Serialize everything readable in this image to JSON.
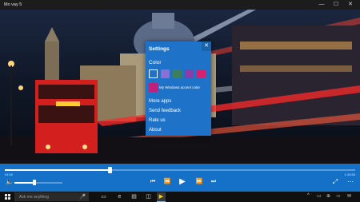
{
  "window": {
    "title": "Mo vay 5",
    "minimize_glyph": "—",
    "maximize_glyph": "☐",
    "close_glyph": "✕"
  },
  "settings": {
    "title": "Settings",
    "close_glyph": "✕",
    "color_label": "Color",
    "swatches": [
      "#1e73c8",
      "#8b6fd6",
      "#3d7f5a",
      "#8e3aa8",
      "#d6226e"
    ],
    "selected_swatch": 0,
    "accent_color": "#c0207a",
    "accent_label": "My Windows accent color",
    "menu": [
      "More apps",
      "Send feedback",
      "Rate us",
      "About"
    ]
  },
  "player": {
    "time_elapsed": "01:02",
    "time_total": "1:33:53",
    "seek_fraction": 0.3,
    "volume_fraction": 0.42,
    "volume_icon": "speaker-icon",
    "buttons": {
      "skip_back": "⏮",
      "rewind": "⏪",
      "play": "▶",
      "fast_forward": "⏩",
      "skip_forward": "⏭",
      "fullscreen": "⤢",
      "more": "⋯"
    }
  },
  "taskbar": {
    "search_placeholder": "Ask me anything",
    "mic_glyph": "🎤",
    "apps": [
      "task-view-icon",
      "edge-icon",
      "file-explorer-icon",
      "store-icon",
      "mo-vay-app-icon"
    ],
    "tray": [
      "^",
      "▭",
      "⊕",
      "◅",
      "✉"
    ]
  },
  "colors": {
    "accent": "#1e73c8",
    "controls_bar": "#1570c8",
    "titlebar": "#1c1c1c",
    "taskbar": "#101010"
  }
}
